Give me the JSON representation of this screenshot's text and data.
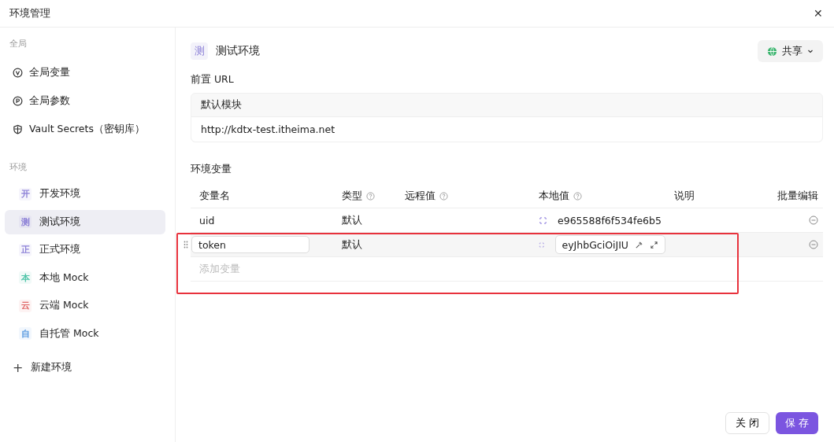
{
  "window": {
    "title": "环境管理",
    "close": "✕"
  },
  "sidebar": {
    "global_heading": "全局",
    "global_items": [
      {
        "kind": "variable",
        "label": "全局变量",
        "selected": false
      },
      {
        "kind": "parameter",
        "label": "全局参数",
        "selected": false
      },
      {
        "kind": "vault",
        "label": "Vault Secrets（密钥库）",
        "selected": false
      }
    ],
    "env_heading": "环境",
    "environments": [
      {
        "badge": "开",
        "label": "开发环境",
        "color": "#8b7fd6",
        "selected": false
      },
      {
        "badge": "测",
        "label": "测试环境",
        "color": "#8b7fd6",
        "selected": true
      },
      {
        "badge": "正",
        "label": "正式环境",
        "color": "#8b7fd6",
        "selected": false
      },
      {
        "badge": "本",
        "label": "本地 Mock",
        "color": "#4fc4a8",
        "selected": false
      },
      {
        "badge": "云",
        "label": "云端 Mock",
        "color": "#e06a6a",
        "selected": false
      },
      {
        "badge": "自",
        "label": "自托管 Mock",
        "color": "#5b9be0",
        "selected": false
      }
    ],
    "new_env": {
      "icon": "+",
      "label": "新建环境"
    }
  },
  "env": {
    "badge": "测",
    "name": "测试环境",
    "share": "共享"
  },
  "prefix_url": {
    "label": "前置 URL",
    "module": "默认模块",
    "url": "http://kdtx-test.itheima.net"
  },
  "variables": {
    "label": "环境变量",
    "columns": [
      {
        "label": "变量名",
        "help": false
      },
      {
        "label": "类型",
        "help": true
      },
      {
        "label": "远程值",
        "help": true
      },
      {
        "label": "本地值",
        "help": true
      },
      {
        "label": "说明",
        "help": false
      },
      {
        "label": "批量编辑",
        "help": false
      }
    ],
    "rows": [
      {
        "name": "uid",
        "type": "默认",
        "local": "e965588f6f534fe6b5",
        "editing": false
      },
      {
        "name": "token",
        "type": "默认",
        "local": "eyJhbGciOiJIU",
        "editing": true
      }
    ],
    "add_placeholder": "添加变量"
  },
  "buttons": {
    "close": "关 闭",
    "save": "保 存"
  }
}
